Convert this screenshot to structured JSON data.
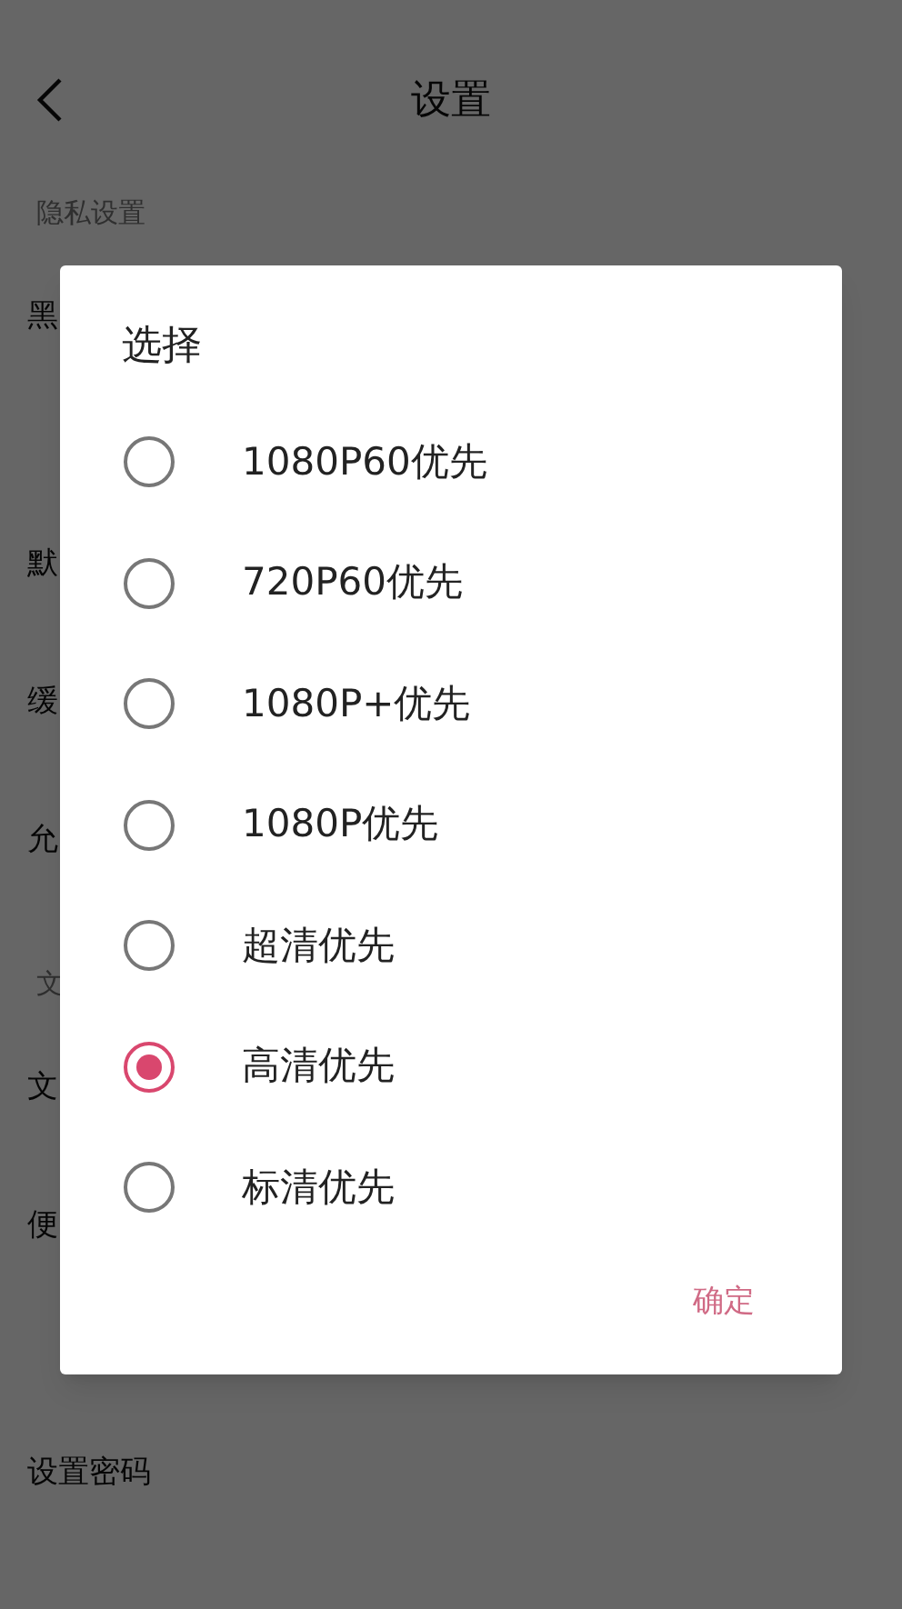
{
  "page": {
    "title": "设置"
  },
  "sections": [
    {
      "label": "隐私设置",
      "items": [
        "黑"
      ]
    },
    {
      "items": [
        "默",
        "缓",
        "允"
      ]
    },
    {
      "label": "文",
      "items": [
        "文",
        "便"
      ]
    },
    {
      "items": [
        "设置密码"
      ]
    }
  ],
  "dialog": {
    "title": "选择",
    "options": [
      {
        "label": "1080P60优先",
        "selected": false
      },
      {
        "label": "720P60优先",
        "selected": false
      },
      {
        "label": "1080P+优先",
        "selected": false
      },
      {
        "label": "1080P优先",
        "selected": false
      },
      {
        "label": "超清优先",
        "selected": false
      },
      {
        "label": "高清优先",
        "selected": true
      },
      {
        "label": "标清优先",
        "selected": false
      }
    ],
    "confirm": "确定"
  }
}
